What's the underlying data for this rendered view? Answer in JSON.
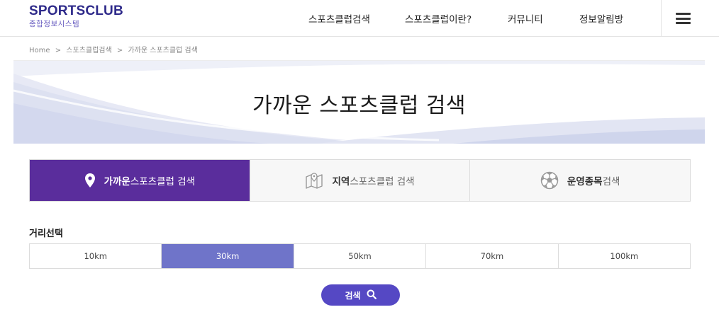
{
  "logo": {
    "title": "SPORTSCLUB",
    "subtitle": "종합정보시스템"
  },
  "nav": [
    {
      "label": "스포츠클럽검색"
    },
    {
      "label": "스포츠클럽이란?"
    },
    {
      "label": "커뮤니티"
    },
    {
      "label": "정보알림방"
    }
  ],
  "breadcrumb": [
    "Home",
    ">",
    "스포츠클럽검색",
    ">",
    "가까운 스포츠클럽 검색"
  ],
  "banner": {
    "title": "가까운 스포츠클럽 검색"
  },
  "tabs": [
    {
      "strong": "가까운",
      "rest": " 스포츠클럽 검색",
      "icon": "map-pin-icon",
      "active": true
    },
    {
      "strong": "지역",
      "rest": " 스포츠클럽 검색",
      "icon": "map-icon",
      "active": false
    },
    {
      "strong": "운영종목",
      "rest": " 검색",
      "icon": "soccer-ball-icon",
      "active": false
    }
  ],
  "distance": {
    "label": "거리선택",
    "options": [
      "10km",
      "30km",
      "50km",
      "70km",
      "100km"
    ],
    "selected": "30km"
  },
  "search": {
    "label": "검색",
    "icon": "search-icon"
  },
  "colors": {
    "brand": "#2e2a8a",
    "tab_active": "#5a2d9c",
    "distance_active": "#6f74c9",
    "button": "#5548c4"
  }
}
